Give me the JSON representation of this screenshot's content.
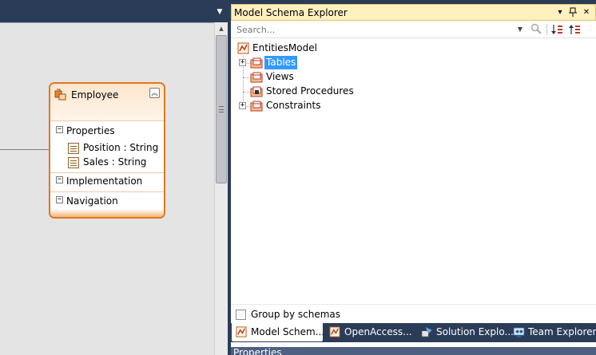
{
  "designer": {
    "tab_dropdown_icon": "dropdown-arrow-icon",
    "entity": {
      "title": "Employee",
      "icon": "entity-icon",
      "sections": {
        "properties": "Properties",
        "implementation": "Implementation",
        "navigation": "Navigation"
      },
      "properties": [
        {
          "label": "Position : String",
          "icon": "property-icon"
        },
        {
          "label": "Sales : String",
          "icon": "property-icon"
        }
      ]
    }
  },
  "explorer": {
    "title": "Model Schema Explorer",
    "title_buttons": [
      "dropdown-icon",
      "pin-icon",
      "close-icon"
    ],
    "search": {
      "placeholder": "Search..."
    },
    "tree": {
      "root": "EntitiesModel",
      "children": [
        {
          "label": "Tables",
          "selected": true,
          "expandable": true
        },
        {
          "label": "Views",
          "selected": false,
          "expandable": false
        },
        {
          "label": "Stored Procedures",
          "selected": false,
          "expandable": false
        },
        {
          "label": "Constraints",
          "selected": false,
          "expandable": true
        }
      ]
    },
    "group_by": {
      "label": "Group by schemas",
      "checked": false
    },
    "bottom_tabs": [
      {
        "label": "Model Schem...",
        "active": true
      },
      {
        "label": "OpenAccess...",
        "active": false
      },
      {
        "label": "Solution Explo...",
        "active": false
      },
      {
        "label": "Team Explorer",
        "active": false
      }
    ],
    "properties_title": "Properties"
  },
  "colors": {
    "chrome": "#2b3c59",
    "entity_border": "#e0781c",
    "title_bar": "#fff0c0",
    "selection": "#3399ff"
  }
}
